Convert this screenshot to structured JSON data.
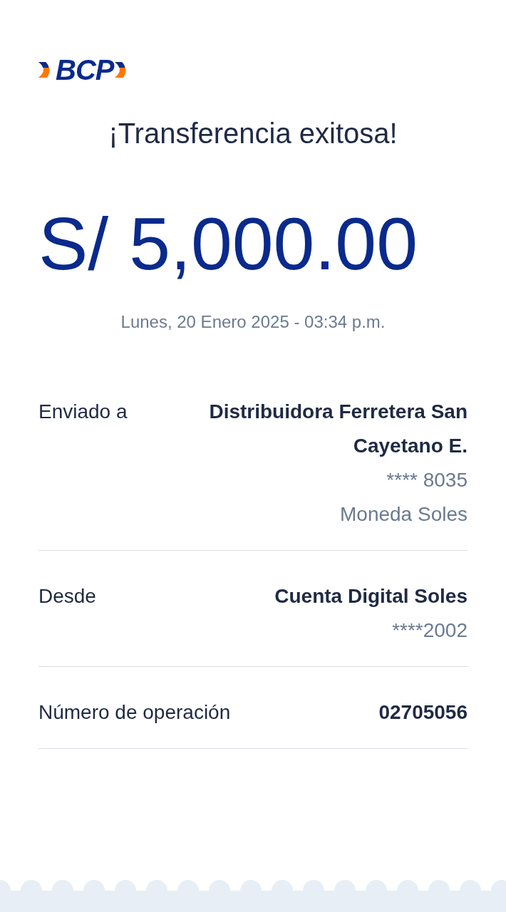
{
  "logo": {
    "text": "BCP"
  },
  "title": "¡Transferencia exitosa!",
  "amount": "S/ 5,000.00",
  "datetime": "Lunes, 20 Enero 2025 - 03:34 p.m.",
  "details": [
    {
      "label": "Enviado a",
      "lines": [
        {
          "kind": "strong",
          "text": "Distribuidora Ferretera San Cayetano E."
        },
        {
          "kind": "muted",
          "text": "**** 8035"
        },
        {
          "kind": "muted",
          "text": "Moneda Soles"
        }
      ]
    },
    {
      "label": "Desde",
      "lines": [
        {
          "kind": "strong",
          "text": "Cuenta Digital Soles"
        },
        {
          "kind": "muted",
          "text": "****2002"
        }
      ]
    },
    {
      "label": "Número de operación",
      "lines": [
        {
          "kind": "strong",
          "text": "02705056"
        }
      ]
    }
  ]
}
